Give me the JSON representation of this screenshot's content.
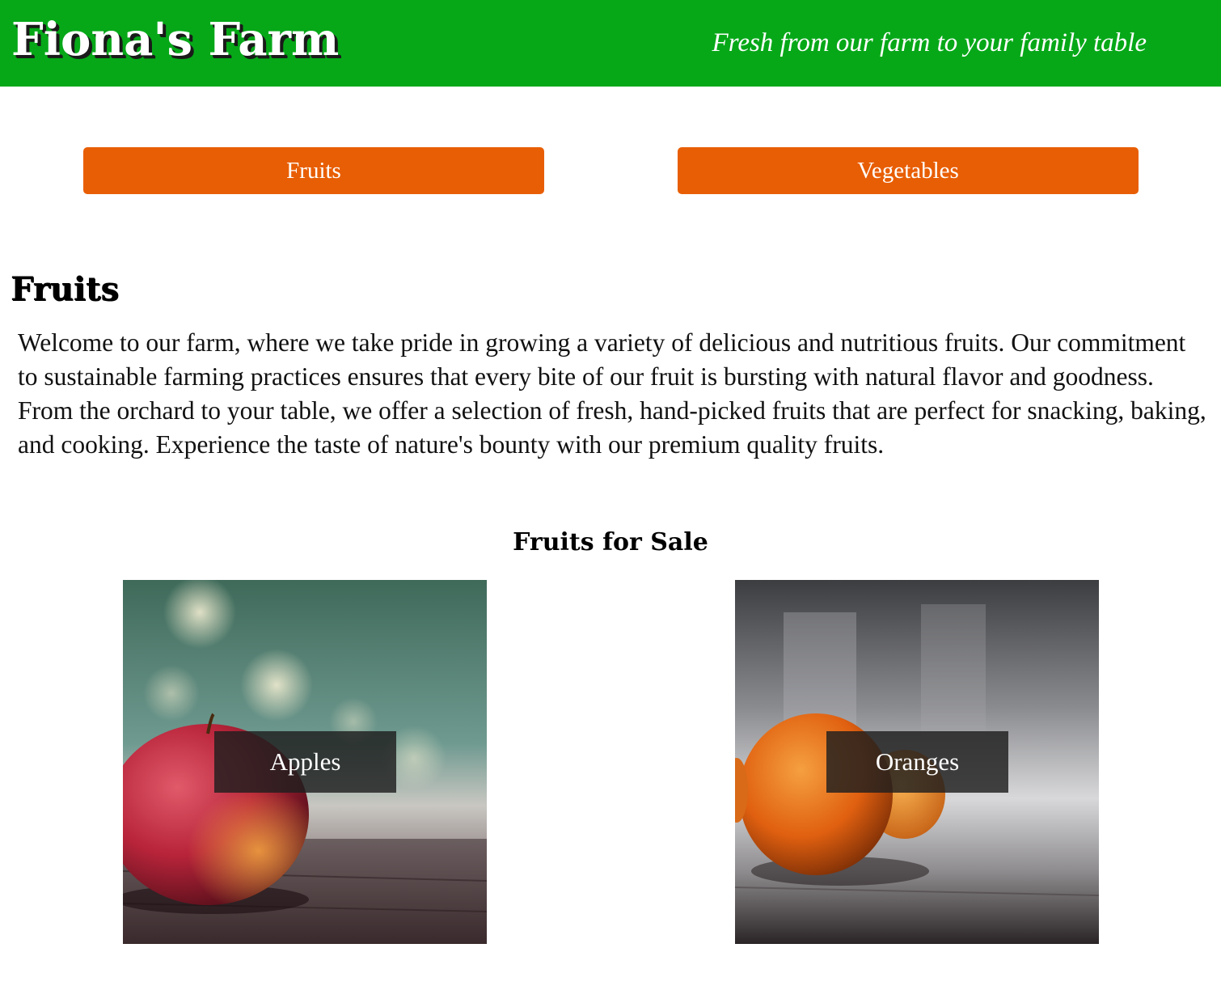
{
  "header": {
    "brand": "Fiona's Farm",
    "tagline": "Fresh from our farm to your family table"
  },
  "nav": {
    "fruits_label": "Fruits",
    "vegetables_label": "Vegetables"
  },
  "section": {
    "title": "Fruits",
    "intro": "Welcome to our farm, where we take pride in growing a variety of delicious and nutritious fruits. Our commitment to sustainable farming practices ensures that every bite of our fruit is bursting with natural flavor and goodness. From the orchard to your table, we offer a selection of fresh, hand-picked fruits that are perfect for snacking, baking, and cooking. Experience the taste of nature's bounty with our premium quality fruits."
  },
  "sale": {
    "title": "Fruits for Sale",
    "products": [
      {
        "name": "Apples",
        "image": "apple-photo"
      },
      {
        "name": "Oranges",
        "image": "orange-photo"
      }
    ]
  },
  "colors": {
    "header_bg": "#06a818",
    "button_bg": "#e85e04",
    "caption_bg": "#1e1e1e"
  }
}
